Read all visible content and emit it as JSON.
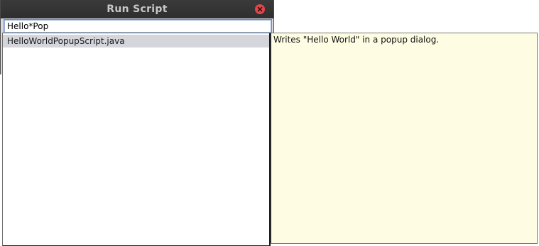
{
  "window": {
    "title": "Run Script",
    "close_icon": "close-icon"
  },
  "search": {
    "value": "Hello*Pop",
    "placeholder": ""
  },
  "results": {
    "items": [
      {
        "label": "HelloWorldPopupScript.java",
        "selected": true
      }
    ]
  },
  "description": {
    "text": "Writes \"Hello World\" in a popup dialog."
  },
  "colors": {
    "titlebar": "#333333",
    "close_button": "#e0474c",
    "selection": "#d4d6dc",
    "description_bg": "#fefde3"
  }
}
